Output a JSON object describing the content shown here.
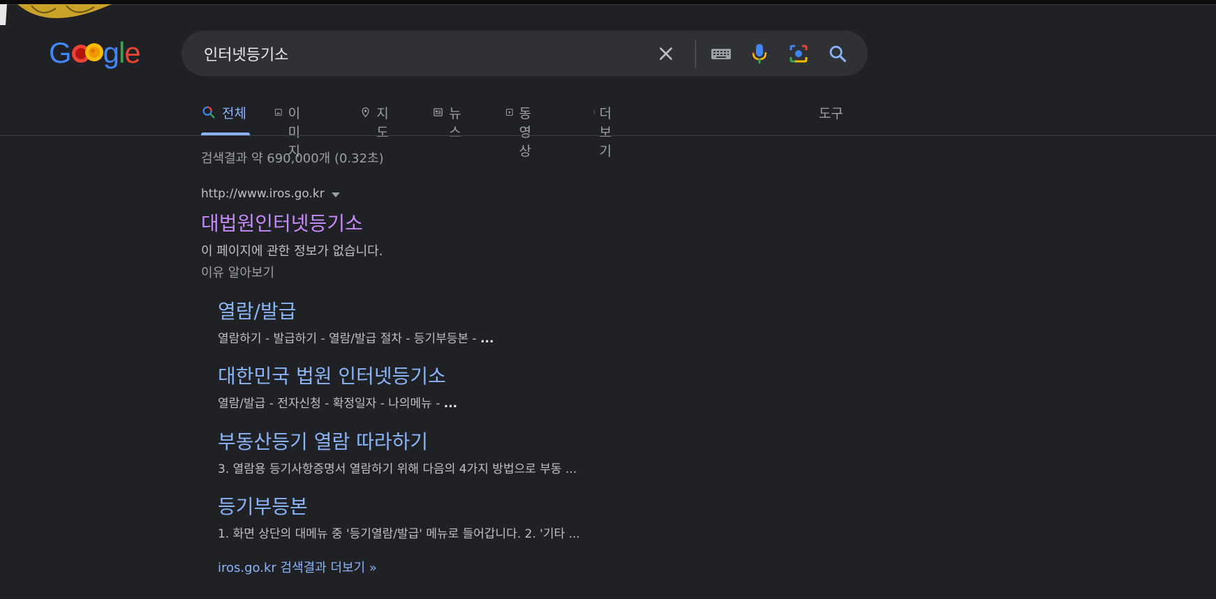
{
  "logo": {
    "text_parts": [
      "G",
      "o",
      "o",
      "g",
      "l",
      "e"
    ]
  },
  "search": {
    "query": "인터넷등기소",
    "clear_icon": "close-icon",
    "keyboard_icon": "keyboard-icon",
    "mic_icon": "mic-icon",
    "camera_icon": "camera-icon",
    "search_icon": "search-icon"
  },
  "tabs": [
    {
      "label": "전체",
      "icon": "search-icon",
      "active": true
    },
    {
      "label": "이미지",
      "icon": "image-icon"
    },
    {
      "label": "지도",
      "icon": "map-pin-icon"
    },
    {
      "label": "뉴스",
      "icon": "news-icon"
    },
    {
      "label": "동영상",
      "icon": "video-icon"
    },
    {
      "label": "더보기",
      "icon": "more-vert-icon"
    }
  ],
  "tools_label": "도구",
  "stats": "검색결과 약 690,000개 (0.32초)",
  "result": {
    "url": "http://www.iros.go.kr",
    "title": "대법원인터넷등기소",
    "description": "이 페이지에 관한 정보가 없습니다.",
    "learn_more": "이유 알아보기"
  },
  "sitelinks": [
    {
      "title": "열람/발급",
      "desc": "열람하기 - 발급하기 - 열람/발급 절차 - 등기부등본 - ",
      "desc_bold": "..."
    },
    {
      "title": "대한민국 법원 인터넷등기소",
      "desc": "열람/발급 - 전자신청 - 확정일자 - 나의메뉴 - ",
      "desc_bold": "..."
    },
    {
      "title": "부동산등기 열람 따라하기",
      "desc": "3. 열람용 등기사항증명서 열람하기 위해 다음의 4가지 방법으로 부동 ...",
      "desc_bold": ""
    },
    {
      "title": "등기부등본",
      "desc": "1. 화면 상단의 대메뉴 중 '등기열람/발급' 메뉴로 들어갑니다. 2. '기타 ...",
      "desc_bold": ""
    }
  ],
  "more_results": "iros.go.kr 검색결과 더보기 »",
  "colors": {
    "background": "#202124",
    "link": "#8ab4f8",
    "visited": "#c58af9",
    "text": "#bdc1c6",
    "muted": "#9aa0a6"
  }
}
